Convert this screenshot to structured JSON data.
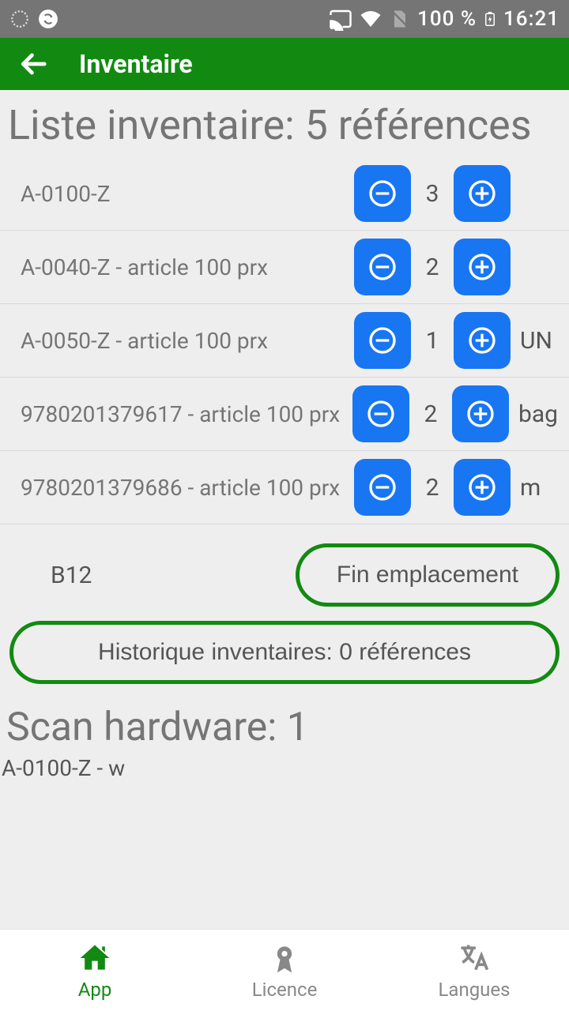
{
  "status": {
    "battery": "100 %",
    "time": "16:21"
  },
  "appbar": {
    "title": "Inventaire"
  },
  "main": {
    "heading": "Liste inventaire: 5 références",
    "items": [
      {
        "label": "A-0100-Z",
        "qty": "3",
        "unit": ""
      },
      {
        "label": "A-0040-Z - article 100 prx",
        "qty": "2",
        "unit": ""
      },
      {
        "label": "A-0050-Z - article 100 prx",
        "qty": "1",
        "unit": "UN"
      },
      {
        "label": "9780201379617 - article 100 prx",
        "qty": "2",
        "unit": "bag"
      },
      {
        "label": "9780201379686 - article 100 prx",
        "qty": "2",
        "unit": "m"
      }
    ],
    "location": "B12",
    "end_location_button": "Fin emplacement",
    "history_button": "Historique inventaires: 0 références",
    "scan_heading": "Scan hardware: 1",
    "scan_line": "A-0100-Z - w"
  },
  "nav": {
    "app": "App",
    "licence": "Licence",
    "langues": "Langues"
  }
}
